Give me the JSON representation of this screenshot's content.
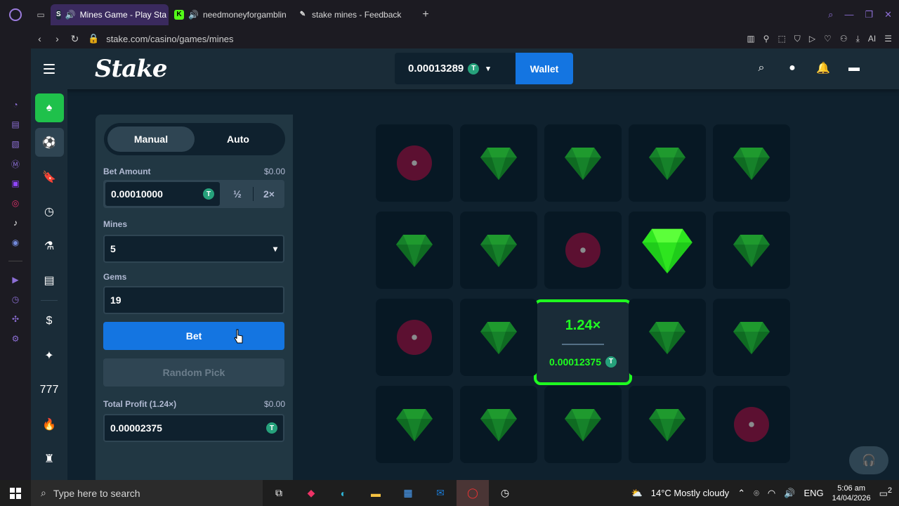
{
  "browser": {
    "tabs": [
      {
        "label": "Mines Game - Play Sta",
        "active": true
      },
      {
        "label": "needmoneyforgamblin",
        "active": false
      },
      {
        "label": "stake mines - Feedback",
        "active": false
      }
    ],
    "url": "stake.com/casino/games/mines",
    "ai_label": "AI"
  },
  "header": {
    "logo": "Stake",
    "balance": "0.00013289",
    "currency_symbol": "T",
    "wallet_label": "Wallet"
  },
  "panel": {
    "mode_manual": "Manual",
    "mode_auto": "Auto",
    "bet_amount_label": "Bet Amount",
    "bet_amount_usd": "$0.00",
    "bet_amount_value": "0.00010000",
    "half_label": "½",
    "double_label": "2×",
    "mines_label": "Mines",
    "mines_value": "5",
    "gems_label": "Gems",
    "gems_value": "19",
    "bet_label": "Bet",
    "random_pick_label": "Random Pick",
    "total_profit_label": "Total Profit (1.24×)",
    "total_profit_usd": "$0.00",
    "total_profit_value": "0.00002375"
  },
  "game": {
    "grid": [
      [
        "mine",
        "gem",
        "gem",
        "gem",
        "gem"
      ],
      [
        "gem",
        "gem",
        "mine",
        "gem-revealed",
        "gem"
      ],
      [
        "mine",
        "gem",
        "cashout",
        "gem",
        "gem"
      ],
      [
        "gem",
        "gem",
        "gem",
        "gem",
        "mine"
      ]
    ],
    "cashout_multiplier": "1.24×",
    "cashout_amount": "0.00012375"
  },
  "taskbar": {
    "search_placeholder": "Type here to search",
    "weather": "14°C  Mostly cloudy",
    "language": "ENG",
    "time": "5:06 am",
    "date": "14/04/2026",
    "notifications": "2"
  },
  "colors": {
    "accent_green": "#1fff20",
    "button_blue": "#1475e1",
    "bg_dark": "#0f212e",
    "panel": "#213743"
  }
}
